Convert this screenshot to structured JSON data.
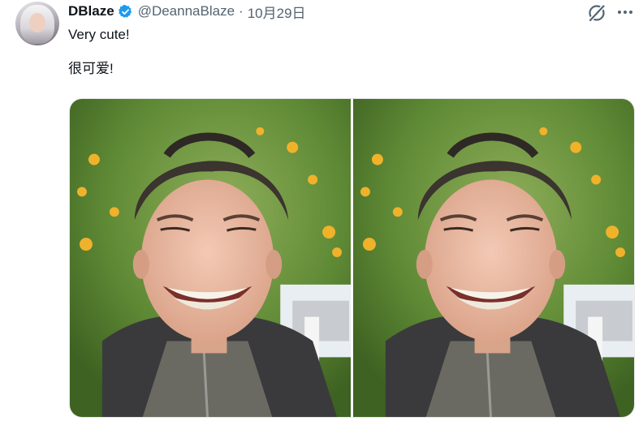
{
  "author": {
    "display_name": "DBlaze",
    "handle": "@DeannaBlaze",
    "separator": "·",
    "date": "10月29日",
    "verified": true,
    "verified_color": "#1d9bf0"
  },
  "tweet": {
    "text_line1": "Very cute!",
    "text_line2": "很可爱!"
  },
  "media": {
    "photos": [
      {
        "subject": "smiling person under orange tree"
      },
      {
        "subject": "smiling person under orange tree"
      }
    ]
  },
  "icons": {
    "grok": "grok-icon",
    "more": "more-icon",
    "avatar": "avatar"
  }
}
